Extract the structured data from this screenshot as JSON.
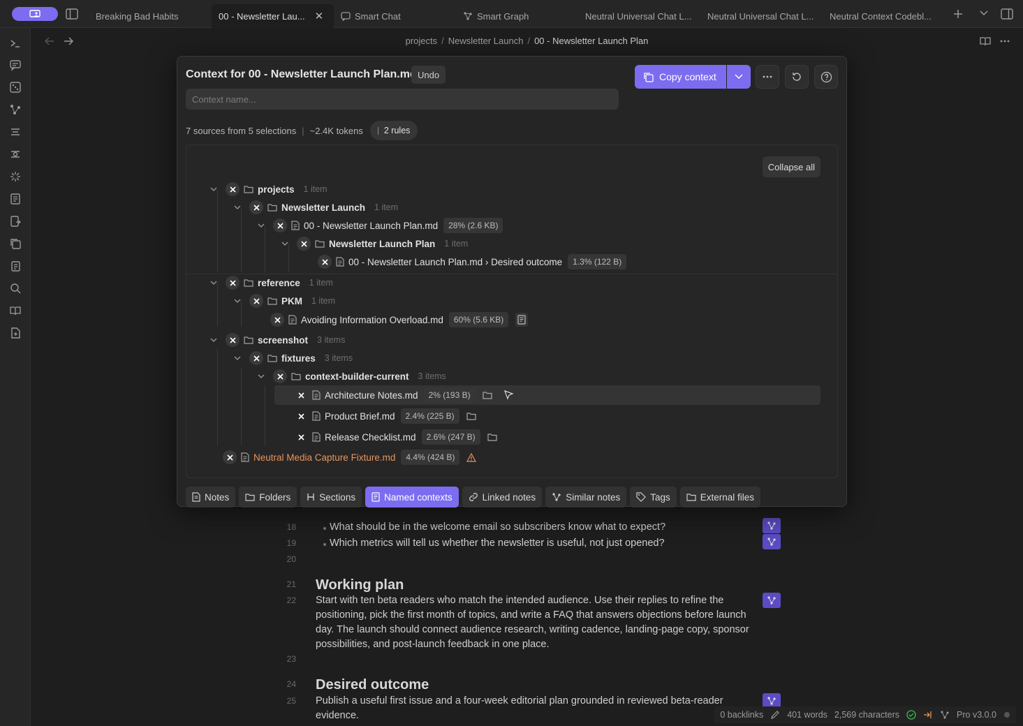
{
  "tabs": [
    {
      "label": "Breaking Bad Habits"
    },
    {
      "label": "00 - Newsletter Lau...",
      "active": true
    },
    {
      "label": "Smart Chat"
    },
    {
      "label": "Smart Graph"
    },
    {
      "label": "Neutral Universal Chat L..."
    },
    {
      "label": "Neutral Universal Chat L..."
    },
    {
      "label": "Neutral Context Codebl..."
    }
  ],
  "breadcrumb": {
    "part1": "projects",
    "part2": "Newsletter Launch",
    "current": "00 - Newsletter Launch Plan",
    "sep": "/"
  },
  "editor": {
    "lines": [
      {
        "no": "18",
        "text": "What should be in the welcome email so subscribers know what to expect?"
      },
      {
        "no": "19",
        "text": "Which metrics will tell us whether the newsletter is useful, not just opened?"
      },
      {
        "no": "20",
        "text": ""
      },
      {
        "no": "21",
        "heading": "Working plan"
      },
      {
        "no": "22",
        "text": "Start with ten beta readers who match the intended audience. Use their replies to refine the positioning, pick the first month of topics, and write a FAQ that answers objections before launch day. The launch should connect audience research, writing cadence, landing-page copy, sponsor possibilities, and post-launch feedback in one place."
      },
      {
        "no": "23",
        "text": ""
      },
      {
        "no": "24",
        "heading": "Desired outcome"
      },
      {
        "no": "25",
        "text": "Publish a useful first issue and a four-week editorial plan grounded in reviewed beta-reader evidence."
      }
    ]
  },
  "status": {
    "backlinks": "0 backlinks",
    "words": "401 words",
    "chars": "2,569 characters",
    "version": "Pro v3.0.0"
  },
  "modal": {
    "title": "Context for 00 - Newsletter Launch Plan.md",
    "undo": "Undo",
    "copy": "Copy context",
    "name_placeholder": "Context name...",
    "sources": "7 sources from 5 selections",
    "tokens": "~2.4K tokens",
    "rules": "2 rules",
    "collapse_all": "Collapse all",
    "tree": [
      {
        "name": "projects",
        "count": "1 item"
      },
      {
        "name": "Newsletter Launch",
        "count": "1 item"
      },
      {
        "name": "00 - Newsletter Launch Plan.md",
        "size": "28% (2.6 KB)"
      },
      {
        "name": "Newsletter Launch Plan",
        "count": "1 item"
      },
      {
        "name": "00 - Newsletter Launch Plan.md › Desired outcome",
        "size": "1.3% (122 B)"
      },
      {
        "name": "reference",
        "count": "1 item"
      },
      {
        "name": "PKM",
        "count": "1 item"
      },
      {
        "name": "Avoiding Information Overload.md",
        "size": "60% (5.6 KB)"
      },
      {
        "name": "screenshot",
        "count": "3 items"
      },
      {
        "name": "fixtures",
        "count": "3 items"
      },
      {
        "name": "context-builder-current",
        "count": "3 items"
      },
      {
        "name": "Architecture Notes.md",
        "size": "2% (193 B)"
      },
      {
        "name": "Product Brief.md",
        "size": "2.4% (225 B)"
      },
      {
        "name": "Release Checklist.md",
        "size": "2.6% (247 B)"
      },
      {
        "name": "Neutral Media Capture Fixture.md",
        "size": "4.4% (424 B)"
      }
    ],
    "filter_tabs": [
      {
        "label": "Notes"
      },
      {
        "label": "Folders"
      },
      {
        "label": "Sections"
      },
      {
        "label": "Named contexts",
        "active": true
      },
      {
        "label": "Linked notes"
      },
      {
        "label": "Similar notes"
      },
      {
        "label": "Tags"
      },
      {
        "label": "External files"
      }
    ]
  },
  "colors": {
    "accent": "#7b6cf0",
    "warning": "#e8945a",
    "ok": "#3fb950"
  }
}
